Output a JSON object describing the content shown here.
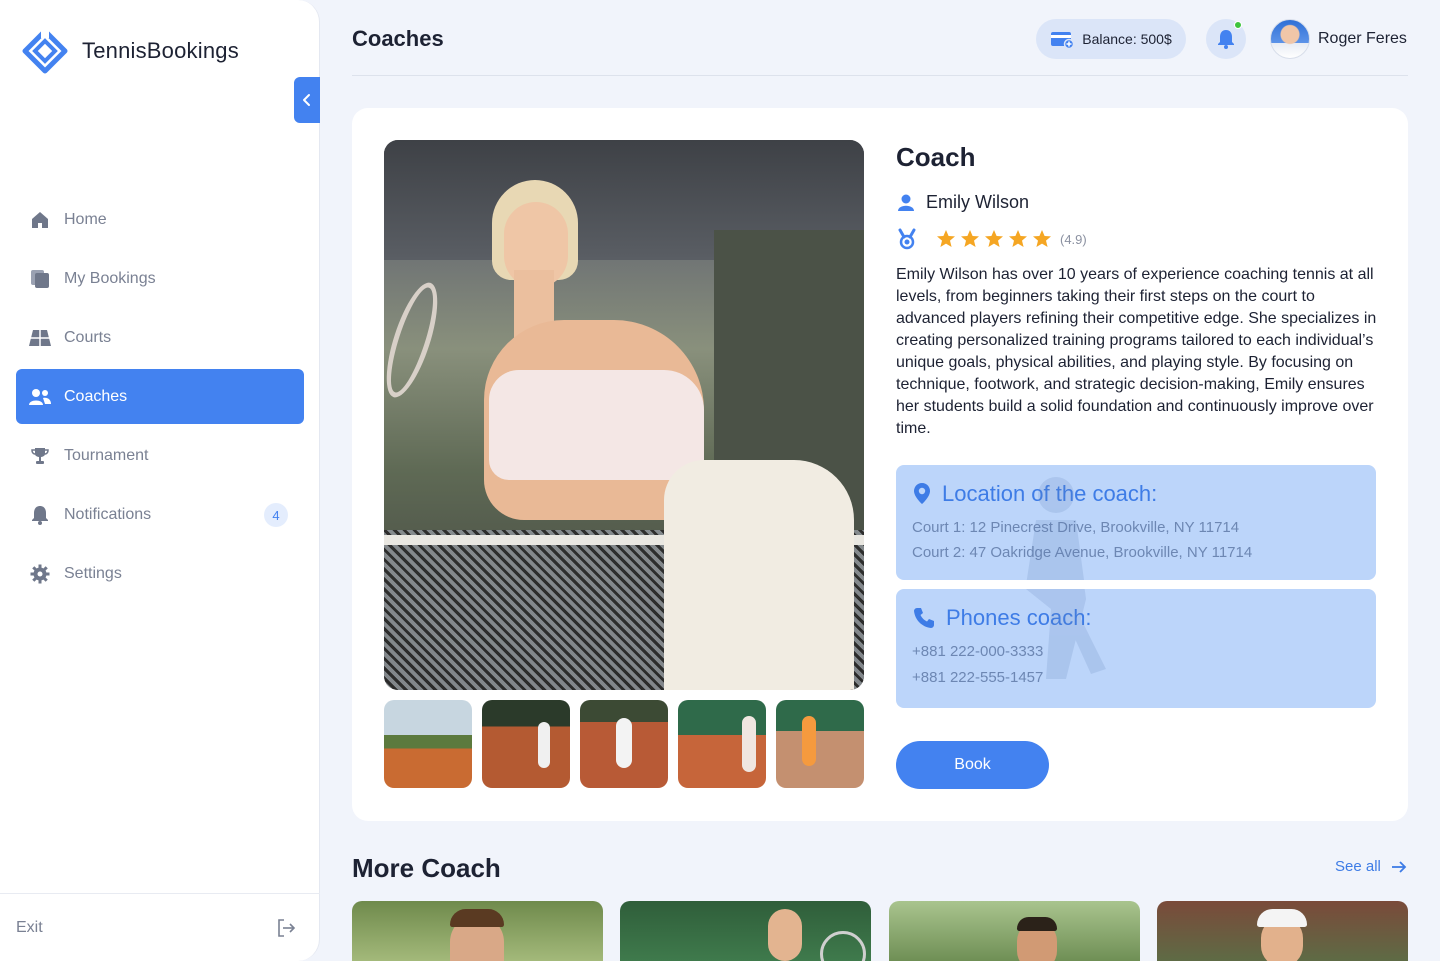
{
  "app": {
    "name": "TennisBookings"
  },
  "sidebar": {
    "items": [
      {
        "label": "Home",
        "icon": "home-icon"
      },
      {
        "label": "My Bookings",
        "icon": "bookings-icon"
      },
      {
        "label": "Courts",
        "icon": "court-icon"
      },
      {
        "label": "Coaches",
        "icon": "coaches-icon",
        "active": true
      },
      {
        "label": "Tournament",
        "icon": "trophy-icon"
      },
      {
        "label": "Notifications",
        "icon": "bell-icon",
        "badge": "4"
      },
      {
        "label": "Settings",
        "icon": "gear-icon"
      }
    ],
    "exit_label": "Exit"
  },
  "header": {
    "title": "Coaches",
    "balance": "Balance: 500$",
    "user_name": "Roger Feres"
  },
  "coach": {
    "heading": "Coach",
    "name": "Emily Wilson",
    "rating_stars": 5,
    "rating_value": "(4.9)",
    "bio": "Emily Wilson has over 10 years of experience coaching tennis at all levels, from beginners taking their first steps on the court to advanced players refining their competitive edge. She specializes in creating personalized training programs tailored to each individual’s unique goals, physical abilities, and playing style. By focusing on technique, footwork, and strategic decision-making, Emily ensures her students build a solid foundation and continuously improve over time.",
    "location": {
      "title": "Location of the coach:",
      "lines": [
        "Court 1: 12 Pinecrest Drive, Brookville, NY 11714",
        "Court 2: 47 Oakridge Avenue, Brookville, NY 11714"
      ]
    },
    "phones": {
      "title": "Phones coach:",
      "lines": [
        "+881 222-000-3333",
        "+881 222-555-1457"
      ]
    },
    "book_label": "Book"
  },
  "more": {
    "title": "More Coach",
    "see_all": "See all"
  },
  "colors": {
    "accent": "#4382f0",
    "info_bg": "#bcd5fa",
    "star": "#f5a623",
    "online": "#3ec43e"
  }
}
